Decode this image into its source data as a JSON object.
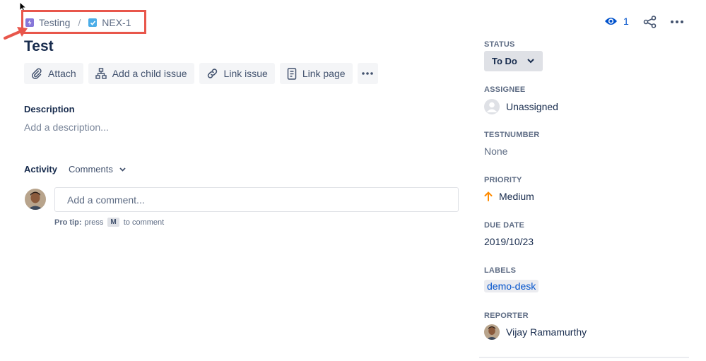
{
  "breadcrumb": {
    "project": "Testing",
    "separator": "/",
    "issue_key": "NEX-1"
  },
  "issue": {
    "title": "Test"
  },
  "toolbar": {
    "attach": "Attach",
    "add_child": "Add a child issue",
    "link_issue": "Link issue",
    "link_page": "Link page"
  },
  "description": {
    "heading": "Description",
    "placeholder": "Add a description..."
  },
  "activity": {
    "heading": "Activity",
    "filter": "Comments",
    "comment_placeholder": "Add a comment...",
    "pro_tip_label": "Pro tip:",
    "pro_tip_press": "press",
    "pro_tip_key": "M",
    "pro_tip_suffix": "to comment"
  },
  "header_actions": {
    "watchers": "1"
  },
  "sidebar": {
    "status_label": "STATUS",
    "status_value": "To Do",
    "assignee_label": "ASSIGNEE",
    "assignee_value": "Unassigned",
    "testnumber_label": "TESTNUMBER",
    "testnumber_value": "None",
    "priority_label": "PRIORITY",
    "priority_value": "Medium",
    "due_date_label": "DUE DATE",
    "due_date_value": "2019/10/23",
    "labels_label": "LABELS",
    "labels_value": "demo-desk",
    "reporter_label": "REPORTER",
    "reporter_value": "Vijay Ramamurthy"
  },
  "colors": {
    "highlight": "#e8564b",
    "project_icon": "#8777d9",
    "task_icon": "#4bade8",
    "priority_arrow": "#ff8b00",
    "link_blue": "#0052cc"
  },
  "icons": [
    "project-icon",
    "task-checkbox-icon",
    "attach-paperclip-icon",
    "hierarchy-icon",
    "link-icon",
    "page-icon",
    "more-icon",
    "chevron-down-icon",
    "eye-icon",
    "share-icon",
    "user-placeholder-icon",
    "priority-arrow-up-icon",
    "mouse-cursor-icon",
    "annotation-arrow-icon"
  ]
}
